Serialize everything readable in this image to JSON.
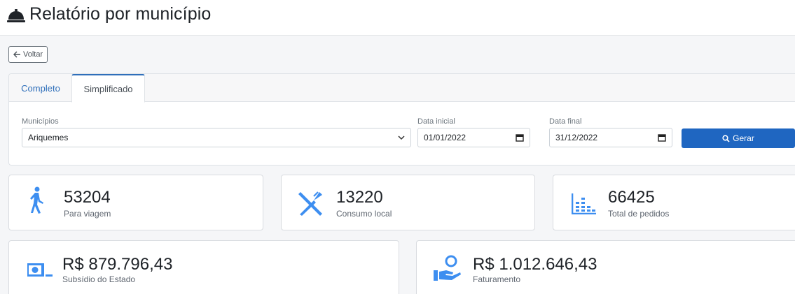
{
  "header": {
    "title": "Relatório por município",
    "icon": "service-bell-icon"
  },
  "back_button": {
    "label": "Voltar",
    "icon": "arrow-left-icon"
  },
  "tabs": [
    {
      "label": "Completo",
      "active": false
    },
    {
      "label": "Simplificado",
      "active": true
    }
  ],
  "filters": {
    "municipio": {
      "label": "Municípios",
      "value": "Ariquemes"
    },
    "data_inicial": {
      "label": "Data inicial",
      "value": "01/01/2022"
    },
    "data_final": {
      "label": "Data final",
      "value": "31/12/2022"
    },
    "submit_label": "Gerar"
  },
  "stats": {
    "para_viagem": {
      "value": "53204",
      "caption": "Para viagem",
      "icon": "walking-person-icon"
    },
    "consumo_local": {
      "value": "13220",
      "caption": "Consumo local",
      "icon": "fork-knife-icon"
    },
    "total_pedidos": {
      "value": "66425",
      "caption": "Total de pedidos",
      "icon": "bar-chart-icon"
    },
    "subsidio": {
      "value": "R$ 879.796,43",
      "caption": "Subsídio do Estado",
      "icon": "money-bill-icon"
    },
    "faturamento": {
      "value": "R$ 1.012.646,43",
      "caption": "Faturamento",
      "icon": "hand-holding-coin-icon"
    }
  },
  "colors": {
    "accent": "#1f66c1",
    "icon": "#3d8ef0"
  }
}
